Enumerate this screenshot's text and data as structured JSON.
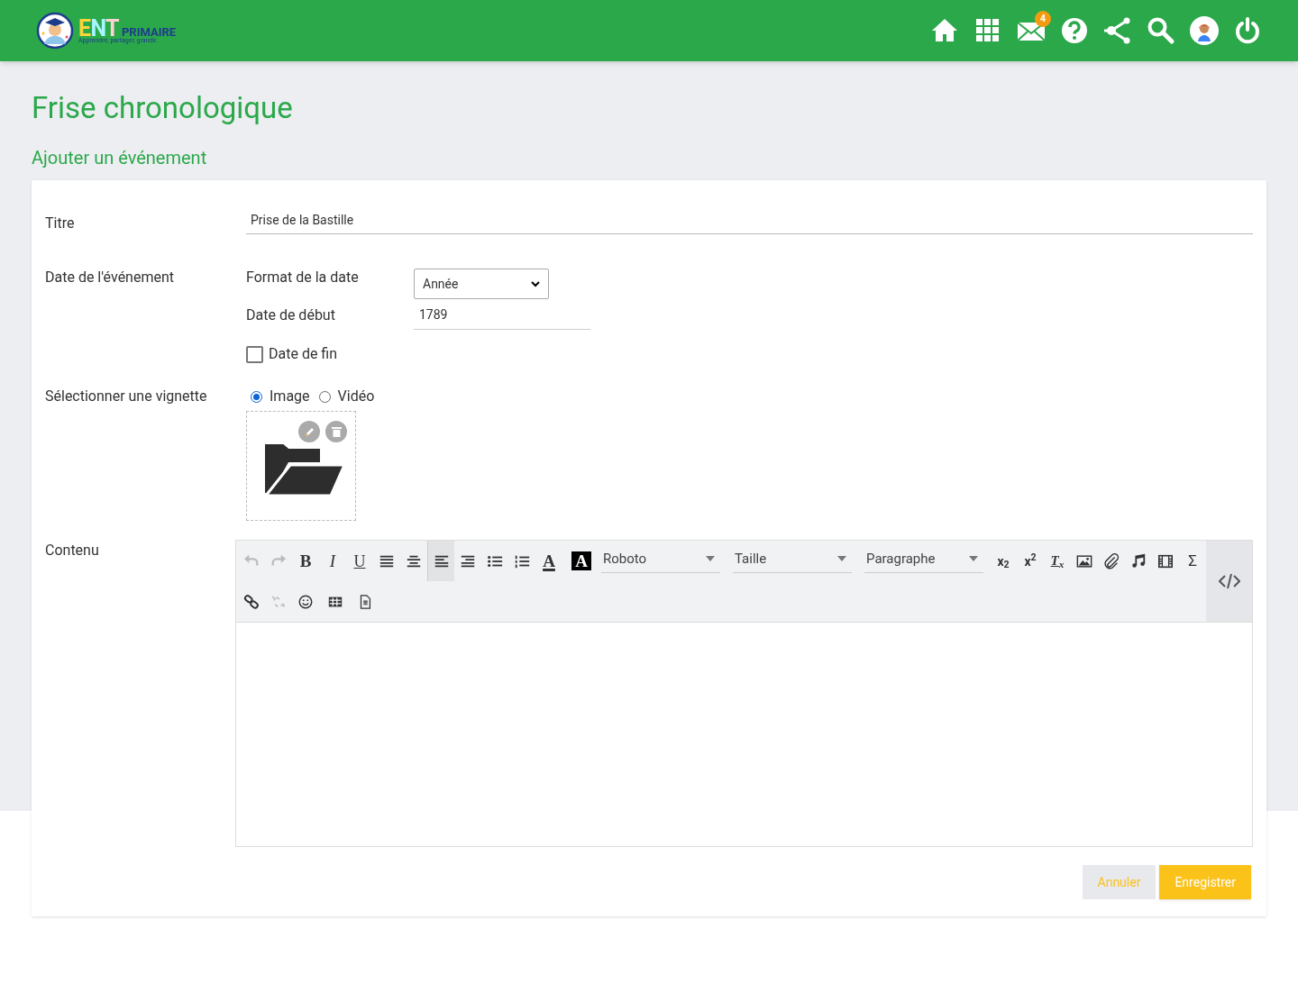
{
  "header": {
    "logo": {
      "brand": "ENT",
      "product": "PRIMAIRE",
      "tagline": "Apprendre, partager, grandir."
    },
    "icons": [
      {
        "kind": "home"
      },
      {
        "kind": "apps"
      },
      {
        "kind": "mail",
        "badge": "4"
      },
      {
        "kind": "help"
      },
      {
        "kind": "share"
      },
      {
        "kind": "search"
      },
      {
        "kind": "avatar"
      },
      {
        "kind": "power"
      }
    ]
  },
  "page_title": "Frise chronologique",
  "section_title": "Ajouter un événement",
  "form": {
    "title": {
      "label": "Titre",
      "value": "Prise de la Bastille"
    },
    "date": {
      "label": "Date de l'événement",
      "format_label": "Format de la date",
      "format_value": "Année",
      "start_label": "Date de début",
      "start_value": "1789",
      "end_label": "Date de fin",
      "end_checked": false
    },
    "thumbnail": {
      "label": "Sélectionner une vignette",
      "options": [
        {
          "label": "Image",
          "selected": true
        },
        {
          "label": "Vidéo",
          "selected": false
        }
      ]
    },
    "content": {
      "label": "Contenu",
      "toolbar_rows": [
        [
          {
            "kind": "undo",
            "disabled": true,
            "selected": false
          },
          {
            "kind": "redo",
            "disabled": true,
            "selected": false
          },
          {
            "kind": "bold",
            "label": "B",
            "disabled": false,
            "selected": false
          },
          {
            "kind": "italic",
            "label": "I",
            "disabled": false,
            "selected": false
          },
          {
            "kind": "underline",
            "label": "U",
            "disabled": false,
            "selected": false
          },
          {
            "kind": "justify",
            "disabled": false,
            "selected": false
          },
          {
            "kind": "center",
            "disabled": false,
            "selected": false
          },
          {
            "kind": "left",
            "disabled": false,
            "selected": true
          },
          {
            "kind": "right",
            "disabled": false,
            "selected": false
          },
          {
            "kind": "bullets",
            "disabled": false,
            "selected": false
          },
          {
            "kind": "numbers",
            "disabled": false,
            "selected": false
          },
          {
            "kind": "forecolor",
            "label": "A",
            "disabled": false,
            "selected": false
          },
          {
            "kind": "backcolor",
            "label": "A",
            "disabled": false,
            "selected": false
          },
          {
            "kind": "select",
            "value": "Roboto"
          },
          {
            "kind": "select",
            "value": "Taille"
          },
          {
            "kind": "select",
            "value": "Paragraphe"
          },
          {
            "kind": "script",
            "label": "x$_{2}$",
            "disabled": false,
            "selected": false
          },
          {
            "kind": "script",
            "label": "x$^{2}$",
            "disabled": false,
            "selected": false
          },
          {
            "kind": "clear",
            "label": "T$_{x}$",
            "disabled": false,
            "selected": false
          },
          {
            "kind": "image",
            "disabled": false,
            "selected": false
          },
          {
            "kind": "attach",
            "disabled": false,
            "selected": false
          },
          {
            "kind": "audio",
            "disabled": false,
            "selected": false
          },
          {
            "kind": "video",
            "disabled": false,
            "selected": false
          },
          {
            "kind": "sigma",
            "label": "Σ",
            "disabled": false,
            "selected": false
          }
        ],
        [
          {
            "kind": "link",
            "disabled": false,
            "selected": false
          },
          {
            "kind": "unlink",
            "disabled": true,
            "selected": false
          },
          {
            "kind": "emoji",
            "disabled": false,
            "selected": false
          },
          {
            "kind": "table",
            "disabled": false,
            "selected": false
          },
          {
            "kind": "template",
            "disabled": false,
            "selected": false
          }
        ]
      ]
    }
  },
  "buttons": [
    {
      "label": "Annuler",
      "kind": "secondary"
    },
    {
      "label": "Enregistrer",
      "kind": "primary"
    }
  ]
}
